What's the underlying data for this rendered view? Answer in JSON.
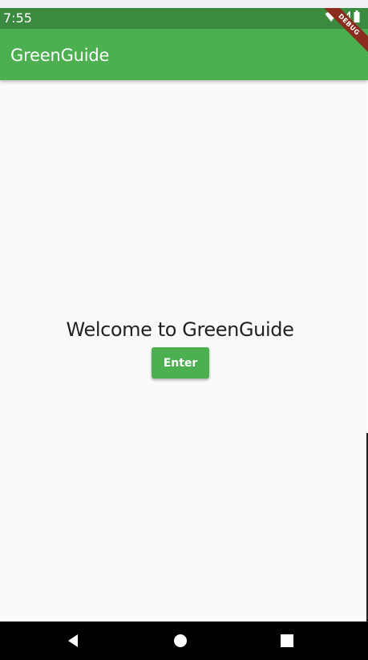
{
  "status_bar": {
    "time": "7:55",
    "icons": [
      "wifi-icon",
      "signal-icon",
      "battery-icon"
    ]
  },
  "app_bar": {
    "title": "GreenGuide"
  },
  "debug_banner": {
    "label": "DEBUG"
  },
  "main": {
    "welcome_text": "Welcome to GreenGuide",
    "enter_button_label": "Enter"
  },
  "nav_bar": {
    "buttons": [
      "back-icon",
      "home-icon",
      "recents-icon"
    ]
  },
  "colors": {
    "primary": "#4caf50",
    "status_bar": "#3a8a40",
    "background": "#fafafa",
    "debug_ribbon": "#8b2c1e"
  }
}
